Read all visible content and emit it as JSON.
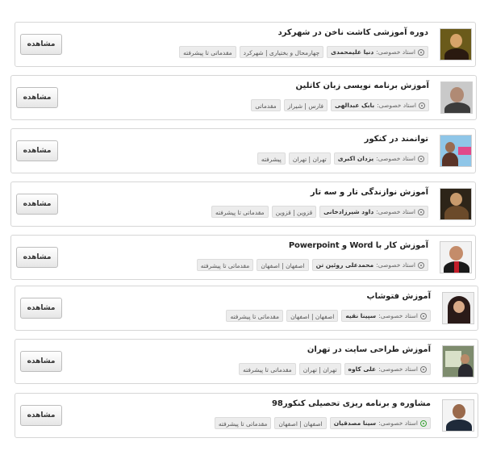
{
  "button_label": "مشاهده",
  "teacher_label": "استاد خصوصی:",
  "courses": [
    {
      "title": "دوره آموزشی کاشت ناخن در شهرکرد",
      "teacher": "دنیا علیمحمدی",
      "location": "چهارمحال و بختیاری | شهرکرد",
      "level": "مقدماتی تا پیشرفته",
      "verified": false
    },
    {
      "title": "آموزش برنامه نویسی زبان کاتلین",
      "teacher": "بابک عبدالهی",
      "location": "فارس | شیراز",
      "level": "مقدماتی",
      "verified": false
    },
    {
      "title": "توانمند در کنکور",
      "teacher": "یزدان اکبری",
      "location": "تهران | تهران",
      "level": "پیشرفته",
      "verified": false
    },
    {
      "title": "آموزش نوازندگی تار و سه تار",
      "teacher": "داود شیرزادخانی",
      "location": "قزوین | قزوین",
      "level": "مقدماتی تا پیشرفته",
      "verified": false
    },
    {
      "title": "آموزش کار با Word و Powerpoint",
      "teacher": "محمدعلی روئین تن",
      "location": "اصفهان | اصفهان",
      "level": "مقدماتی تا پیشرفته",
      "verified": false
    },
    {
      "title": "آموزش فتوشاپ",
      "teacher": "سپینا نقیه",
      "location": "اصفهان | اصفهان",
      "level": "مقدماتی تا پیشرفته",
      "verified": false
    },
    {
      "title": "آموزش طراحی سایت در تهران",
      "teacher": "علی کاوه",
      "location": "تهران | تهران",
      "level": "مقدماتی تا پیشرفته",
      "verified": false
    },
    {
      "title": "مشاوره و برنامه ریزی تحصیلی کنکور98",
      "teacher": "سینا مصدقیان",
      "location": "اصفهان | اصفهان",
      "level": "مقدماتی تا پیشرفته",
      "verified": true
    }
  ]
}
